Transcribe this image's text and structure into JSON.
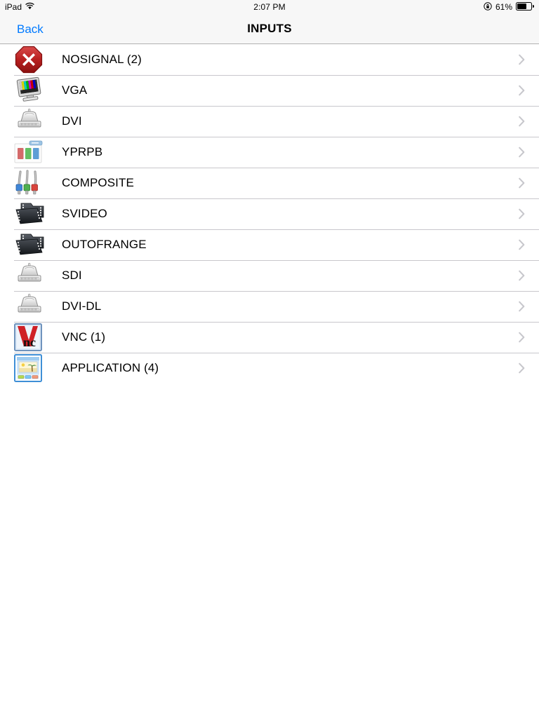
{
  "statusbar": {
    "carrier": "iPad",
    "wifi_icon": "wifi-icon",
    "time": "2:07 PM",
    "rotation_lock_icon": "rotation-lock-icon",
    "battery_percent": "61%",
    "battery_icon": "battery-icon",
    "battery_level": 61
  },
  "navbar": {
    "back_label": "Back",
    "title": "INPUTS",
    "back_color": "#007aff"
  },
  "list": {
    "rows": [
      {
        "label": "NOSIGNAL (2)",
        "icon": "no-signal-icon",
        "accessory": "chevron-right-icon"
      },
      {
        "label": "VGA",
        "icon": "vga-monitor-icon",
        "accessory": "chevron-right-icon"
      },
      {
        "label": "DVI",
        "icon": "dvi-connector-icon",
        "accessory": "chevron-right-icon"
      },
      {
        "label": "YPRPB",
        "icon": "yprpb-bars-icon",
        "accessory": "chevron-right-icon"
      },
      {
        "label": "COMPOSITE",
        "icon": "composite-rca-cables-icon",
        "accessory": "chevron-right-icon"
      },
      {
        "label": "SVIDEO",
        "icon": "film-folder-icon",
        "accessory": "chevron-right-icon"
      },
      {
        "label": "OUTOFRANGE",
        "icon": "film-folder-icon",
        "accessory": "chevron-right-icon"
      },
      {
        "label": "SDI",
        "icon": "dvi-connector-icon",
        "accessory": "chevron-right-icon"
      },
      {
        "label": "DVI-DL",
        "icon": "dvi-connector-icon",
        "accessory": "chevron-right-icon"
      },
      {
        "label": "VNC (1)",
        "icon": "vnc-logo-icon",
        "accessory": "chevron-right-icon"
      },
      {
        "label": "APPLICATION (4)",
        "icon": "application-window-icon",
        "accessory": "chevron-right-icon"
      }
    ]
  },
  "colors": {
    "accent": "#007aff",
    "bar_background": "#f7f7f7",
    "separator": "#c8c7cc",
    "chevron": "#c7c7cc",
    "text": "#000000"
  }
}
